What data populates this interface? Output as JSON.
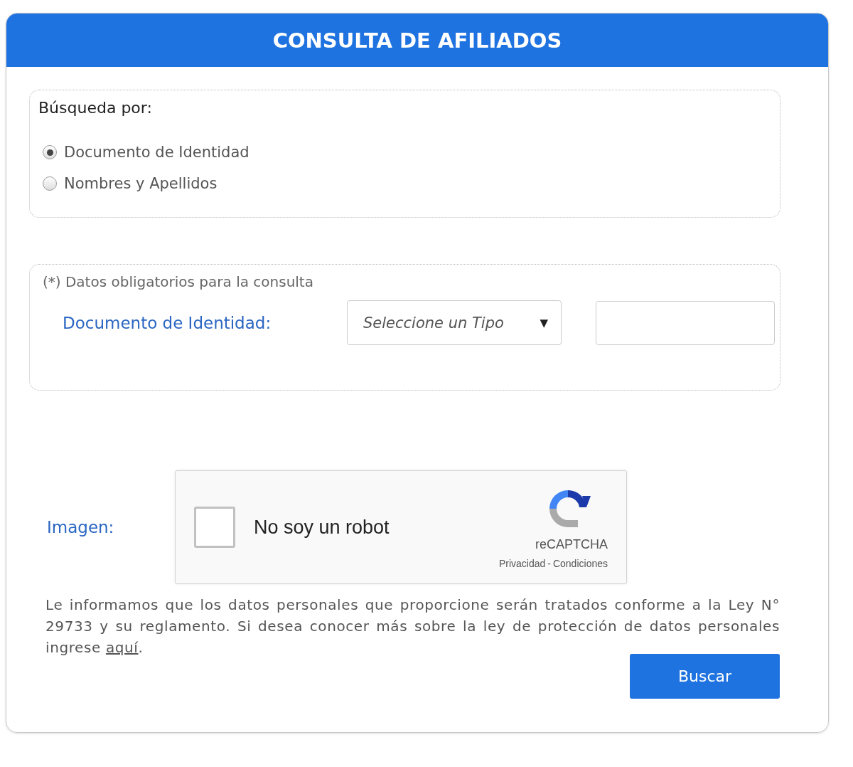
{
  "panel": {
    "title": "CONSULTA DE AFILIADOS"
  },
  "search_by": {
    "heading": "Búsqueda por:",
    "options": [
      {
        "label": "Documento de Identidad",
        "selected": true
      },
      {
        "label": "Nombres y Apellidos",
        "selected": false
      }
    ]
  },
  "required": {
    "note": "(*) Datos obligatorios para la consulta",
    "label": "Documento de Identidad:",
    "type_select": {
      "placeholder": "Seleccione un Tipo",
      "caret": "▼"
    }
  },
  "captcha": {
    "label": "Imagen:",
    "checkbox_label": "No soy un robot",
    "checked": false,
    "brand": "reCAPTCHA",
    "links": [
      "Privacidad",
      "Condiciones"
    ],
    "separator": "-"
  },
  "notice": {
    "text": "Le informamos que los datos personales que proporcione serán tratados conforme a la Ley N° 29733 y su reglamento. Si desea conocer más sobre la ley de protección de datos personales ingrese ",
    "link": "aquí",
    "end": "."
  },
  "buttons": [
    "Buscar"
  ]
}
